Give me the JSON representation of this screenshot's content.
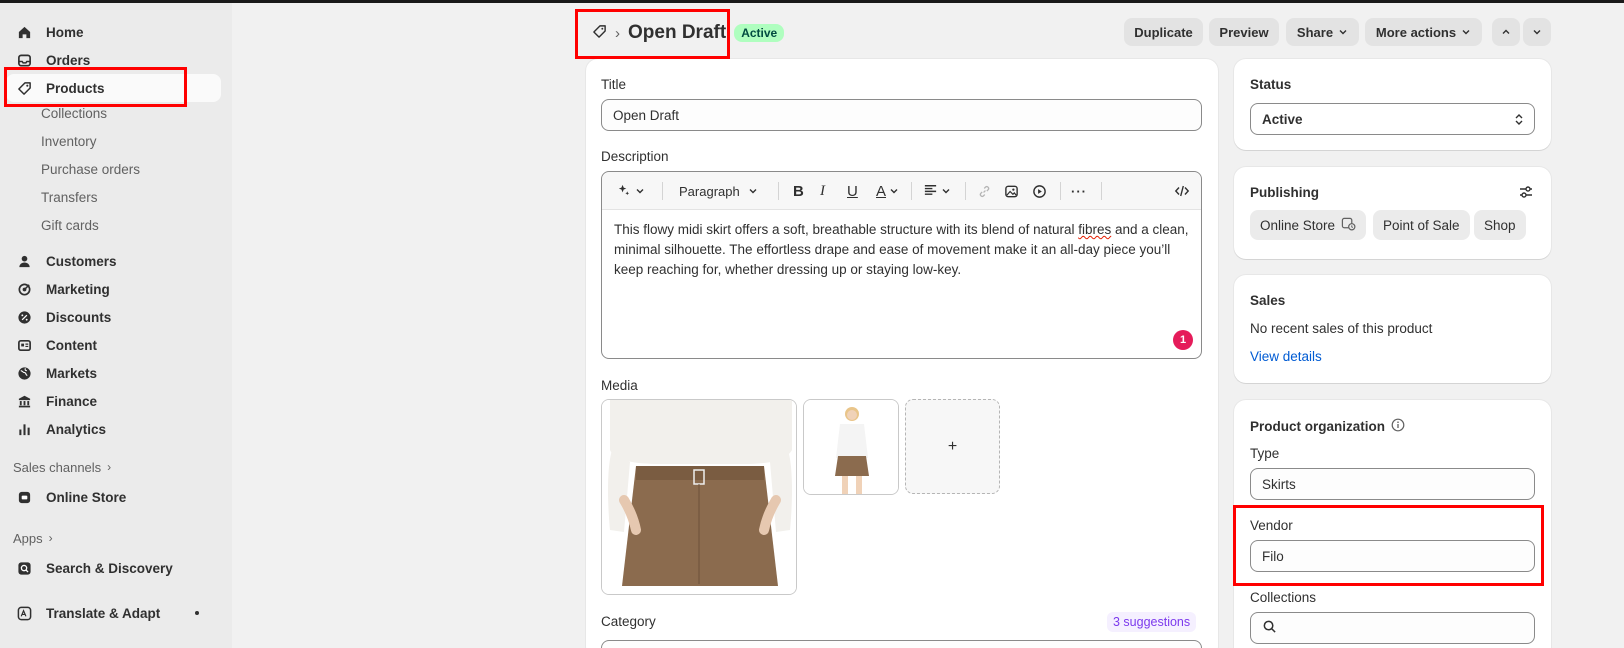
{
  "sidebar": {
    "items": [
      {
        "label": "Home",
        "icon": "home-icon"
      },
      {
        "label": "Orders",
        "icon": "inbox-icon"
      },
      {
        "label": "Products",
        "icon": "tag-icon"
      },
      {
        "label": "Customers",
        "icon": "person-icon"
      },
      {
        "label": "Marketing",
        "icon": "target-icon"
      },
      {
        "label": "Discounts",
        "icon": "discount-icon"
      },
      {
        "label": "Content",
        "icon": "content-icon"
      },
      {
        "label": "Markets",
        "icon": "globe-icon"
      },
      {
        "label": "Finance",
        "icon": "bank-icon"
      },
      {
        "label": "Analytics",
        "icon": "bar-chart-icon"
      }
    ],
    "sub_items": [
      "Collections",
      "Inventory",
      "Purchase orders",
      "Transfers",
      "Gift cards"
    ],
    "sales_channels_label": "Sales channels",
    "online_store_label": "Online Store",
    "apps_label": "Apps",
    "apps": [
      "Search & Discovery",
      "Translate & Adapt"
    ]
  },
  "header": {
    "title": "Open Draft",
    "status_badge": "Active",
    "buttons": {
      "duplicate": "Duplicate",
      "preview": "Preview",
      "share": "Share",
      "more_actions": "More actions"
    }
  },
  "main": {
    "title_label": "Title",
    "title_value": "Open Draft",
    "description_label": "Description",
    "toolbar_paragraph": "Paragraph",
    "description_parts": [
      "This flowy midi skirt offers a soft, breathable structure with its blend of natural ",
      "fibres",
      " and a clean, minimal silhouette. The effortless drape and ease of movement make it an all-day piece you’ll keep reaching for, whether dressing up or staying low-key."
    ],
    "issue_count": "1",
    "media_label": "Media",
    "media_add": "+",
    "category_label": "Category",
    "category_suggestions": "3 suggestions"
  },
  "status_card": {
    "title": "Status",
    "value": "Active"
  },
  "publishing_card": {
    "title": "Publishing",
    "channels": [
      "Online Store",
      "Point of Sale",
      "Shop"
    ]
  },
  "sales_card": {
    "title": "Sales",
    "text": "No recent sales of this product",
    "link": "View details"
  },
  "organization_card": {
    "title": "Product organization",
    "type_label": "Type",
    "type_value": "Skirts",
    "vendor_label": "Vendor",
    "vendor_value": "Filo",
    "collections_label": "Collections"
  },
  "colors": {
    "accent_link": "#005bd3",
    "active_badge_bg": "#affebf",
    "annotation_red": "#ff0000"
  }
}
